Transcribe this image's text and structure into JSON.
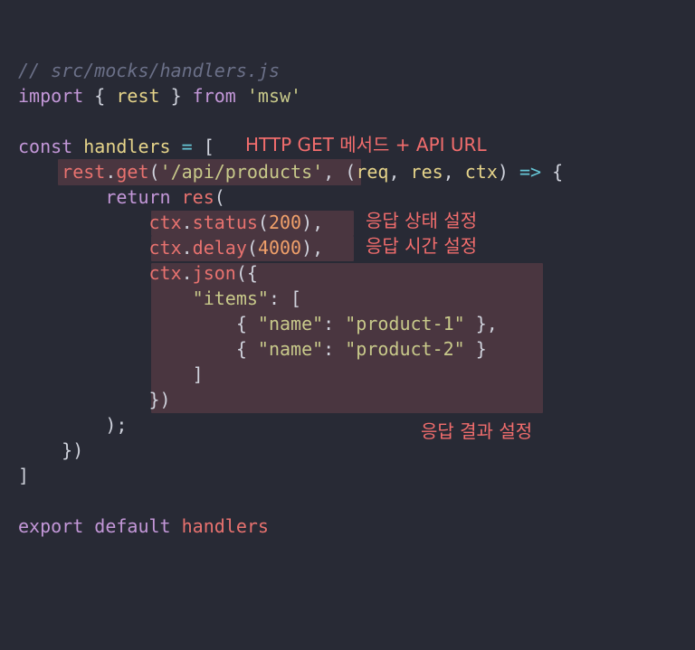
{
  "colors": {
    "background": "#282a35",
    "highlight": "#4a3640",
    "comment": "#6b7088",
    "keyword": "#c397d8",
    "variable": "#e6d48a",
    "string": "#c8c98a",
    "number": "#f0a06a",
    "identifier_red": "#e8726f",
    "operator": "#66c6d6",
    "annotation": "#f26d6d"
  },
  "code_lines": [
    [
      {
        "text": "// src/mocks/handlers.js",
        "cls": "comment"
      }
    ],
    [
      {
        "text": "import",
        "cls": "kw"
      },
      {
        "text": " { ",
        "cls": "punc"
      },
      {
        "text": "rest",
        "cls": "var"
      },
      {
        "text": " } ",
        "cls": "punc"
      },
      {
        "text": "from",
        "cls": "kw"
      },
      {
        "text": " ",
        "cls": "punc"
      },
      {
        "text": "'msw'",
        "cls": "str"
      }
    ],
    [],
    [
      {
        "text": "const",
        "cls": "kw"
      },
      {
        "text": " ",
        "cls": "punc"
      },
      {
        "text": "handlers",
        "cls": "var"
      },
      {
        "text": " ",
        "cls": "punc"
      },
      {
        "text": "=",
        "cls": "cyan"
      },
      {
        "text": " [",
        "cls": "punc"
      }
    ],
    [
      {
        "text": "    ",
        "cls": "punc"
      },
      {
        "text": "rest",
        "cls": "red"
      },
      {
        "text": ".",
        "cls": "punc"
      },
      {
        "text": "get",
        "cls": "red"
      },
      {
        "text": "(",
        "cls": "punc"
      },
      {
        "text": "'/api/products'",
        "cls": "str"
      },
      {
        "text": ", (",
        "cls": "punc"
      },
      {
        "text": "req",
        "cls": "var"
      },
      {
        "text": ", ",
        "cls": "punc"
      },
      {
        "text": "res",
        "cls": "var"
      },
      {
        "text": ", ",
        "cls": "punc"
      },
      {
        "text": "ctx",
        "cls": "var"
      },
      {
        "text": ") ",
        "cls": "punc"
      },
      {
        "text": "=>",
        "cls": "cyan"
      },
      {
        "text": " {",
        "cls": "punc"
      }
    ],
    [
      {
        "text": "        ",
        "cls": "punc"
      },
      {
        "text": "return",
        "cls": "kw"
      },
      {
        "text": " ",
        "cls": "punc"
      },
      {
        "text": "res",
        "cls": "red"
      },
      {
        "text": "(",
        "cls": "punc"
      }
    ],
    [
      {
        "text": "            ",
        "cls": "punc"
      },
      {
        "text": "ctx",
        "cls": "red"
      },
      {
        "text": ".",
        "cls": "punc"
      },
      {
        "text": "status",
        "cls": "red"
      },
      {
        "text": "(",
        "cls": "punc"
      },
      {
        "text": "200",
        "cls": "num"
      },
      {
        "text": "),",
        "cls": "punc"
      }
    ],
    [
      {
        "text": "            ",
        "cls": "punc"
      },
      {
        "text": "ctx",
        "cls": "red"
      },
      {
        "text": ".",
        "cls": "punc"
      },
      {
        "text": "delay",
        "cls": "red"
      },
      {
        "text": "(",
        "cls": "punc"
      },
      {
        "text": "4000",
        "cls": "num"
      },
      {
        "text": "),",
        "cls": "punc"
      }
    ],
    [
      {
        "text": "            ",
        "cls": "punc"
      },
      {
        "text": "ctx",
        "cls": "red"
      },
      {
        "text": ".",
        "cls": "punc"
      },
      {
        "text": "json",
        "cls": "red"
      },
      {
        "text": "({",
        "cls": "punc"
      }
    ],
    [
      {
        "text": "                ",
        "cls": "punc"
      },
      {
        "text": "\"items\"",
        "cls": "str"
      },
      {
        "text": ": [",
        "cls": "punc"
      }
    ],
    [
      {
        "text": "                    { ",
        "cls": "punc"
      },
      {
        "text": "\"name\"",
        "cls": "str"
      },
      {
        "text": ": ",
        "cls": "punc"
      },
      {
        "text": "\"product-1\"",
        "cls": "str"
      },
      {
        "text": " },",
        "cls": "punc"
      }
    ],
    [
      {
        "text": "                    { ",
        "cls": "punc"
      },
      {
        "text": "\"name\"",
        "cls": "str"
      },
      {
        "text": ": ",
        "cls": "punc"
      },
      {
        "text": "\"product-2\"",
        "cls": "str"
      },
      {
        "text": " }",
        "cls": "punc"
      }
    ],
    [
      {
        "text": "                ]",
        "cls": "punc"
      }
    ],
    [
      {
        "text": "            })",
        "cls": "punc"
      }
    ],
    [
      {
        "text": "        );",
        "cls": "punc"
      }
    ],
    [
      {
        "text": "    })",
        "cls": "punc"
      }
    ],
    [
      {
        "text": "]",
        "cls": "punc"
      }
    ],
    [],
    [
      {
        "text": "export",
        "cls": "kw"
      },
      {
        "text": " ",
        "cls": "punc"
      },
      {
        "text": "default",
        "cls": "kw"
      },
      {
        "text": " ",
        "cls": "punc"
      },
      {
        "text": "handlers",
        "cls": "red"
      }
    ]
  ],
  "annotations": {
    "http_get": "HTTP GET 메서드 + API URL",
    "status": "응답 상태 설정",
    "delay": "응답 시간 설정",
    "result": "응답 결과 설정"
  }
}
